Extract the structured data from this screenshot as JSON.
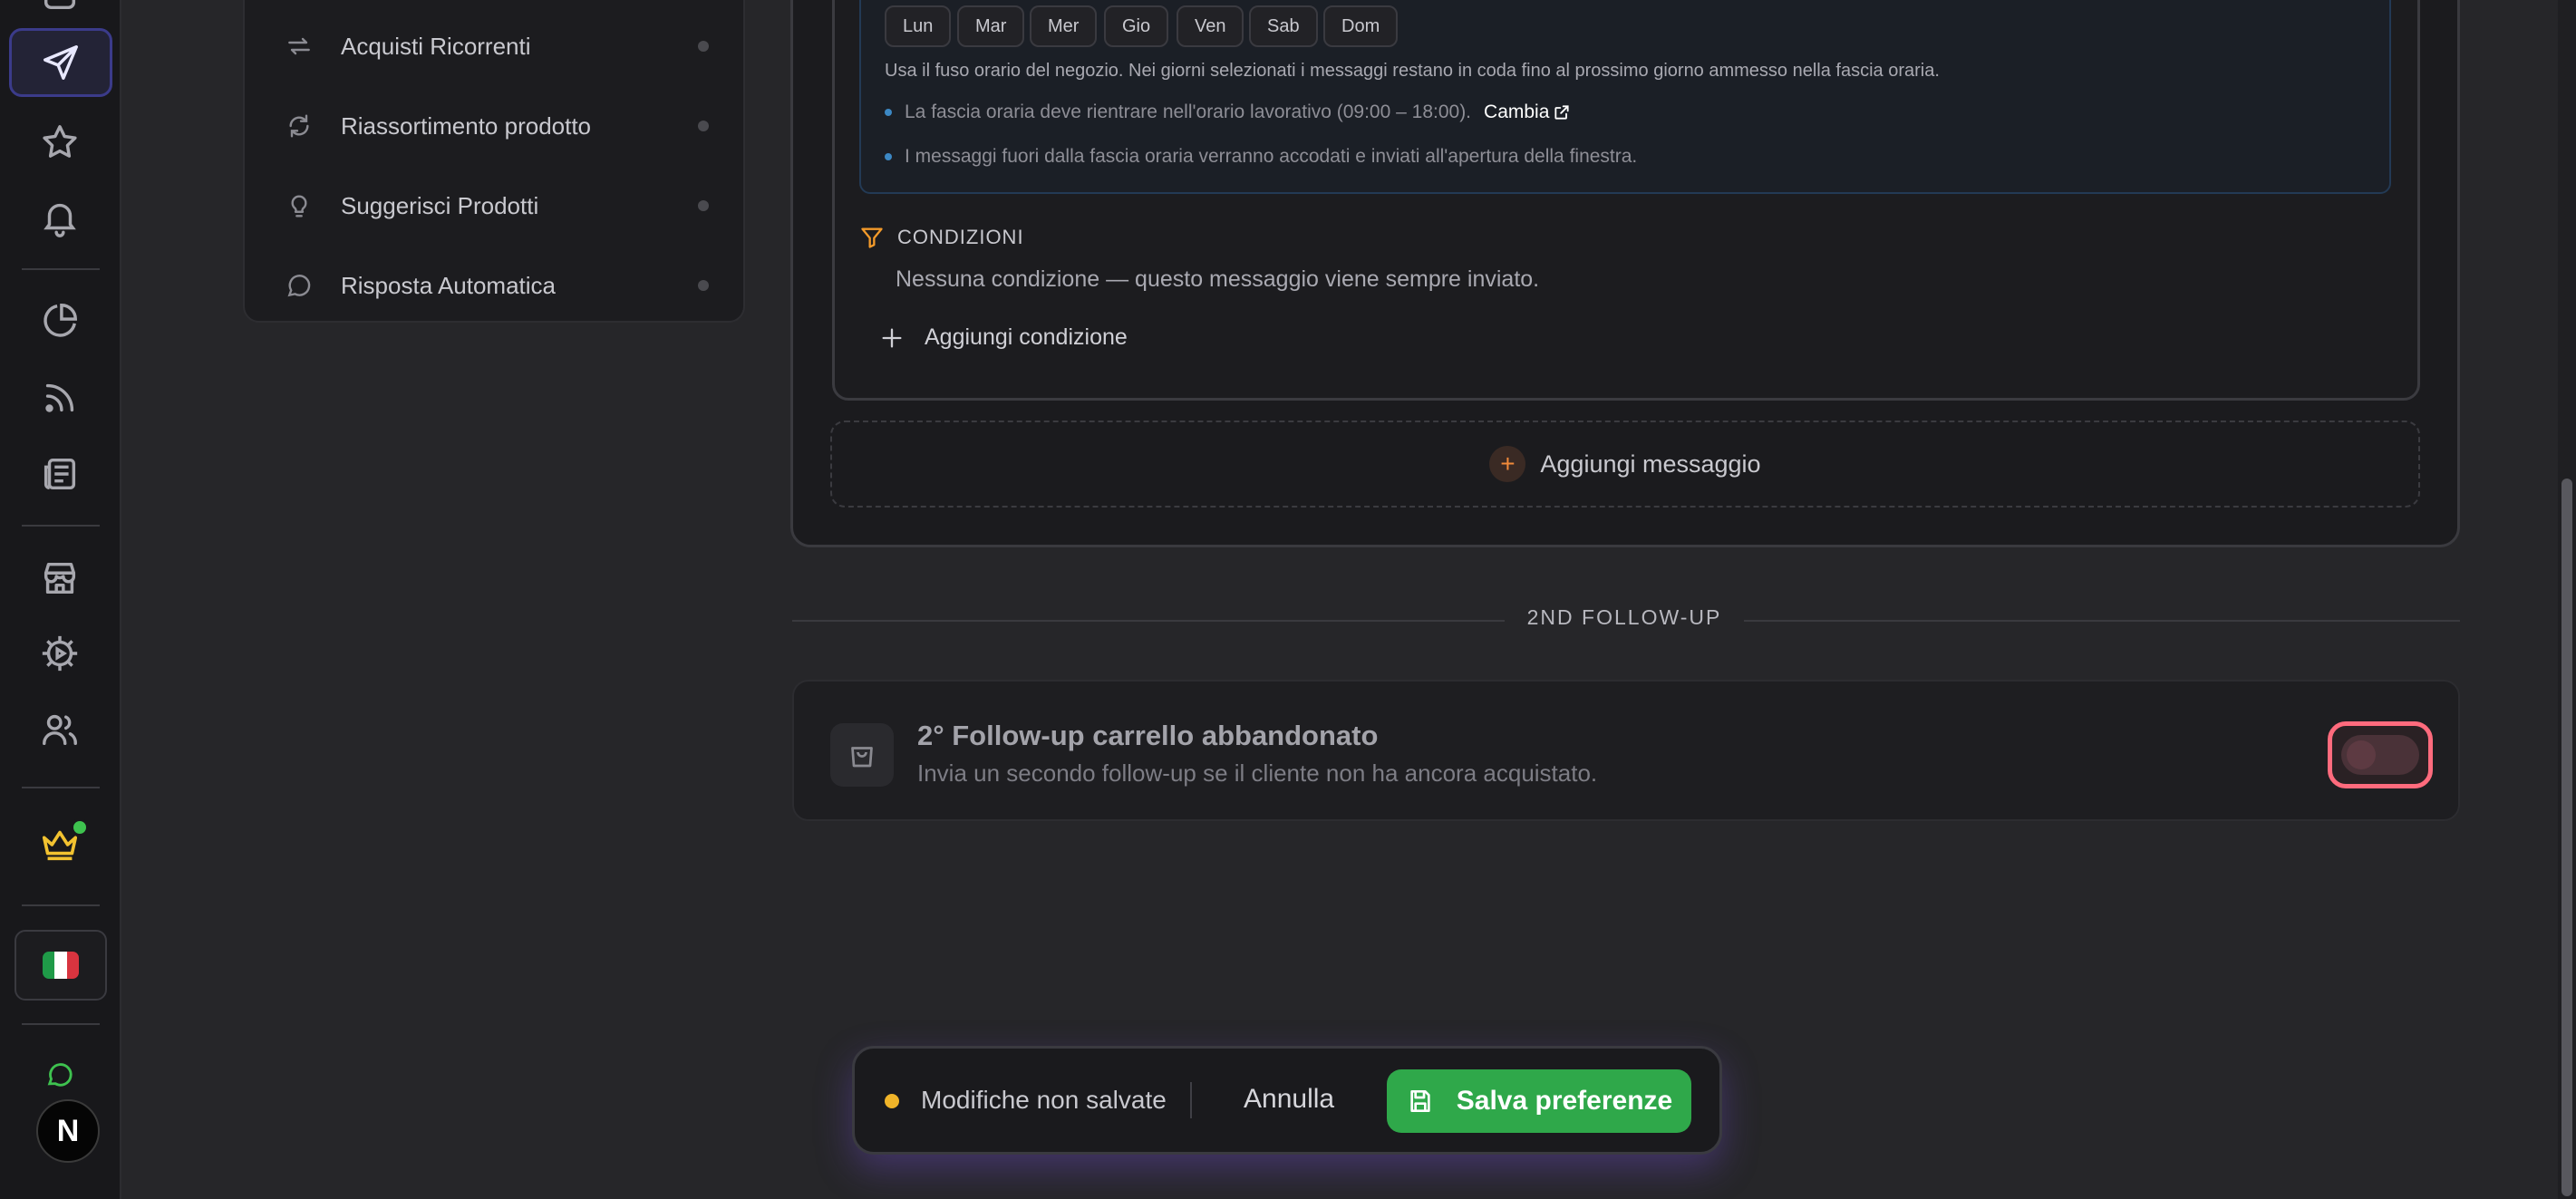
{
  "rail": {
    "icons": [
      "send-icon",
      "star-icon",
      "bell-icon",
      "pie-chart-icon",
      "rss-icon",
      "newspaper-icon",
      "store-icon",
      "settings-icon",
      "users-icon",
      "crown-icon",
      "chat-icon"
    ],
    "avatar_letter": "N",
    "flag_colors": [
      "#1f9a48",
      "#ffffff",
      "#d8343f"
    ],
    "crown_color": "#f2c230",
    "status_dot_color": "#3ec24f"
  },
  "nav": {
    "items": [
      {
        "label": "Acquisti Ricorrenti",
        "icon": "repeat-icon"
      },
      {
        "label": "Riassortimento prodotto",
        "icon": "refresh-icon"
      },
      {
        "label": "Suggerisci Prodotti",
        "icon": "lightbulb-icon"
      },
      {
        "label": "Risposta Automatica",
        "icon": "message-icon"
      }
    ]
  },
  "schedule": {
    "days": [
      "Lun",
      "Mar",
      "Mer",
      "Gio",
      "Ven",
      "Sab",
      "Dom"
    ],
    "timezone_note": "Usa il fuso orario del negozio. Nei giorni selezionati i messaggi restano in coda fino al prossimo giorno ammesso nella fascia oraria.",
    "bullet_1": "La fascia oraria deve rientrare nell'orario lavorativo (09:00 – 18:00).",
    "change_link": "Cambia",
    "bullet_2": "I messaggi fuori dalla fascia oraria verranno accodati e inviati all'apertura della finestra."
  },
  "conditions": {
    "heading": "CONDIZIONI",
    "empty_text": "Nessuna condizione — questo messaggio viene sempre inviato.",
    "add_label": "Aggiungi condizione"
  },
  "add_message_label": "Aggiungi messaggio",
  "section_divider": "2ND FOLLOW-UP",
  "followup": {
    "title": "2° Follow-up carrello abbandonato",
    "subtitle": "Invia un secondo follow-up se il cliente non ha ancora acquistato.",
    "enabled": false
  },
  "savebar": {
    "status": "Modifiche non salvate",
    "cancel": "Annulla",
    "save": "Salva preferenze",
    "status_color": "#f0b429",
    "save_color": "#2fa84a"
  }
}
